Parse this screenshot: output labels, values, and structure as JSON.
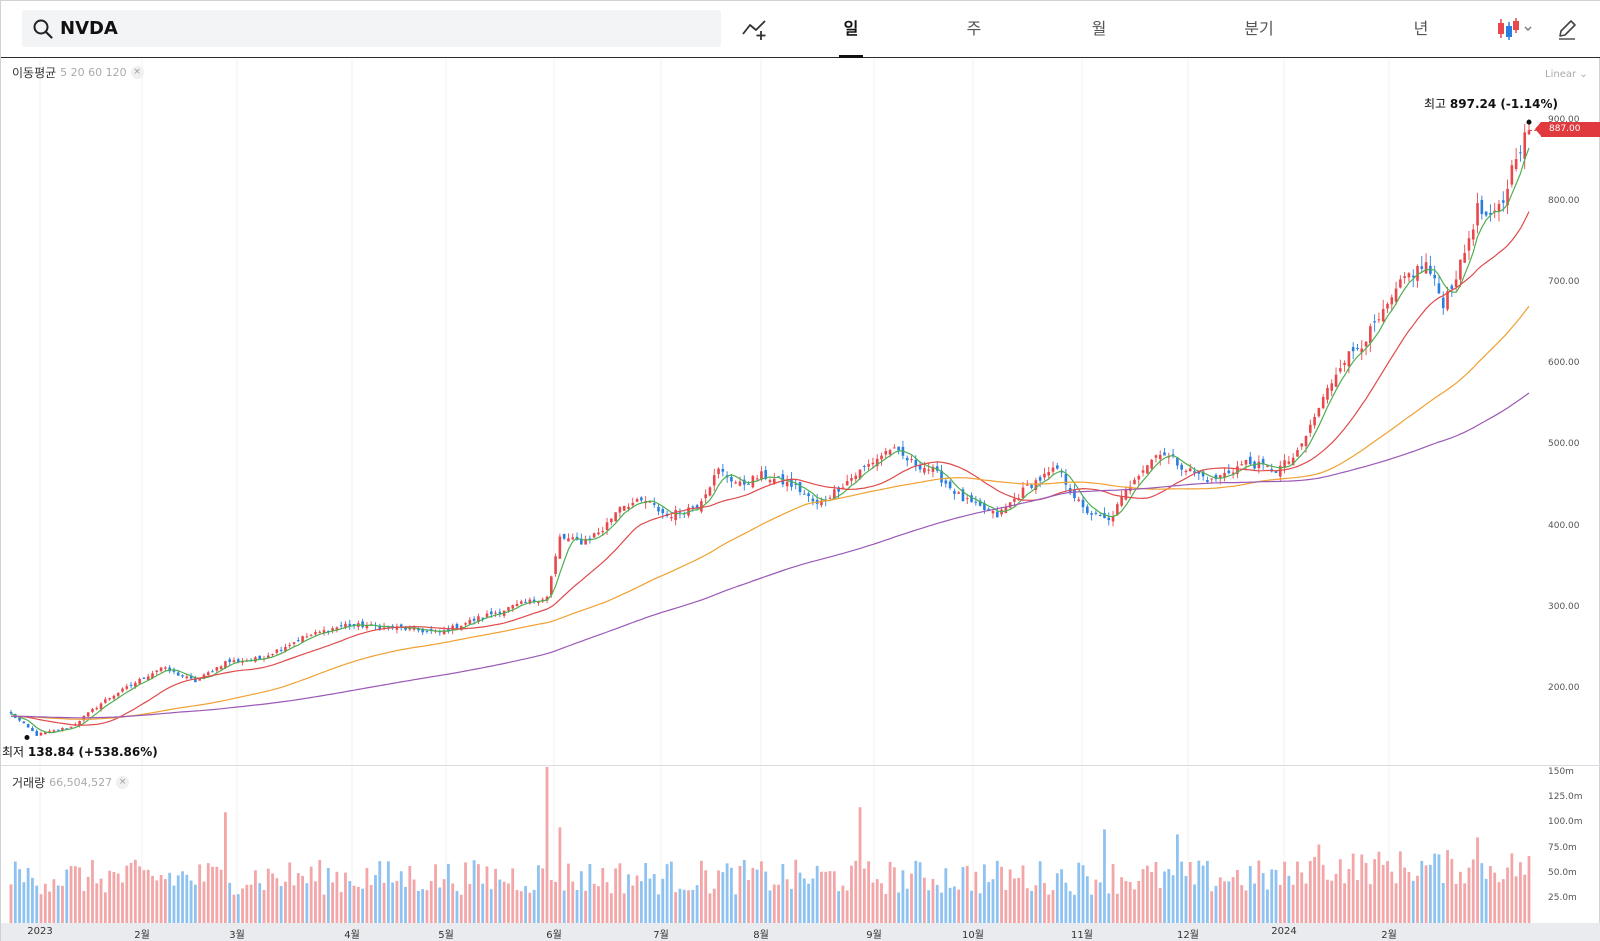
{
  "search": {
    "value": "NVDA",
    "placeholder": ""
  },
  "period_tabs": [
    {
      "label": "일",
      "active": true
    },
    {
      "label": "주",
      "active": false
    },
    {
      "label": "월",
      "active": false
    },
    {
      "label": "분기",
      "active": false
    },
    {
      "label": "년",
      "active": false
    }
  ],
  "toolbar": {
    "indicator_icon": "add-indicator-icon",
    "candle_icon": "candlestick-icon",
    "draw_icon": "pencil-icon"
  },
  "ma_legend": {
    "label": "이동평균",
    "periods": "5 20 60 120",
    "close": "×"
  },
  "volume_legend": {
    "label": "거래량",
    "value": "66,504,527",
    "close": "×"
  },
  "scale_toggle": "Linear ⌄",
  "last_price": "887.00",
  "high": {
    "prefix": "최고",
    "value": "897.24 (-1.14%)"
  },
  "low": {
    "prefix": "최저",
    "value": "138.84 (+538.86%)"
  },
  "colors": {
    "up": "#e8484c",
    "down": "#2a7ee0",
    "ma5": "#4caf50",
    "ma20": "#e04a4a",
    "ma60": "#f0a030",
    "ma120": "#9b59b6",
    "vol_up": "#f2a6a8",
    "vol_down": "#8ec2f0"
  },
  "chart_data": [
    {
      "type": "candlestick",
      "title": "",
      "y_axis_ticks": [
        "200.00",
        "300.00",
        "400.00",
        "500.00",
        "600.00",
        "700.00",
        "800.00",
        "900.00"
      ],
      "ylim": [
        105,
        975
      ],
      "x_axis_labels": [
        "2023",
        "2월",
        "3월",
        "4월",
        "5월",
        "6월",
        "7월",
        "8월",
        "9월",
        "10월",
        "11월",
        "12월",
        "2024",
        "2월"
      ],
      "anchors": [
        [
          0,
          168
        ],
        [
          6,
          142
        ],
        [
          14,
          152
        ],
        [
          22,
          185
        ],
        [
          35,
          225
        ],
        [
          43,
          208
        ],
        [
          50,
          232
        ],
        [
          58,
          236
        ],
        [
          68,
          262
        ],
        [
          78,
          278
        ],
        [
          90,
          274
        ],
        [
          100,
          268
        ],
        [
          110,
          288
        ],
        [
          120,
          305
        ],
        [
          125,
          312
        ],
        [
          128,
          385
        ],
        [
          133,
          380
        ],
        [
          138,
          395
        ],
        [
          142,
          425
        ],
        [
          148,
          430
        ],
        [
          153,
          412
        ],
        [
          160,
          425
        ],
        [
          165,
          468
        ],
        [
          170,
          450
        ],
        [
          175,
          462
        ],
        [
          183,
          448
        ],
        [
          188,
          425
        ],
        [
          195,
          455
        ],
        [
          200,
          475
        ],
        [
          205,
          495
        ],
        [
          210,
          478
        ],
        [
          215,
          468
        ],
        [
          222,
          432
        ],
        [
          230,
          412
        ],
        [
          237,
          448
        ],
        [
          244,
          470
        ],
        [
          250,
          420
        ],
        [
          256,
          405
        ],
        [
          262,
          460
        ],
        [
          268,
          492
        ],
        [
          274,
          470
        ],
        [
          280,
          455
        ],
        [
          288,
          478
        ],
        [
          295,
          468
        ],
        [
          300,
          488
        ],
        [
          305,
          545
        ],
        [
          310,
          600
        ],
        [
          315,
          625
        ],
        [
          320,
          660
        ],
        [
          325,
          705
        ],
        [
          330,
          722
        ],
        [
          334,
          675
        ],
        [
          338,
          720
        ],
        [
          342,
          790
        ],
        [
          345,
          775
        ],
        [
          348,
          800
        ],
        [
          351,
          860
        ],
        [
          354,
          887
        ]
      ],
      "n_days": 355,
      "high": 897.24,
      "low": 138.84,
      "last": 887.0,
      "series": [
        {
          "name": "5",
          "period": 5
        },
        {
          "name": "20",
          "period": 20
        },
        {
          "name": "60",
          "period": 60
        },
        {
          "name": "120",
          "period": 120
        }
      ]
    },
    {
      "type": "bar",
      "title": "",
      "y_axis_ticks": [
        "25.0m",
        "50.0m",
        "75.0m",
        "100.0m",
        "125.0m",
        "150m"
      ],
      "ylim": [
        0,
        155
      ],
      "volume_peaks": [
        [
          50,
          110
        ],
        [
          125,
          155
        ],
        [
          128,
          95
        ],
        [
          198,
          115
        ],
        [
          272,
          88
        ],
        [
          255,
          93
        ],
        [
          305,
          78
        ],
        [
          342,
          85
        ]
      ],
      "last_volume": 66.5
    }
  ]
}
